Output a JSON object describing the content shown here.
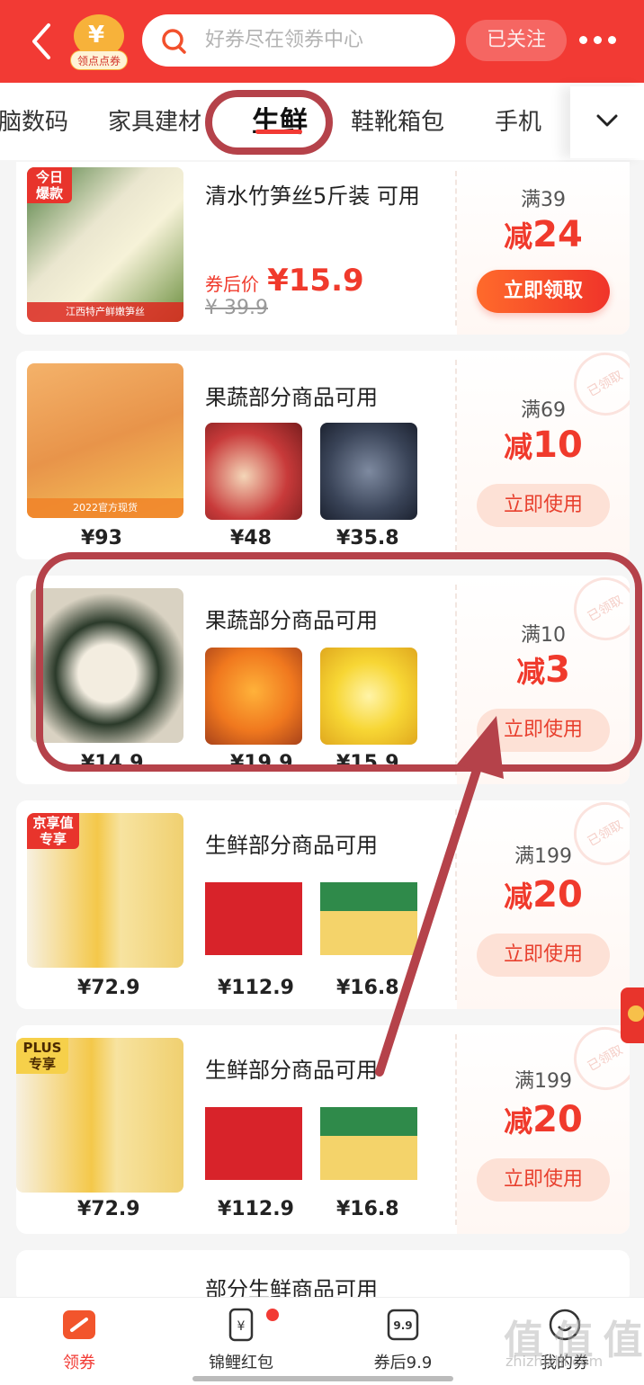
{
  "header": {
    "coupon_center_tag": "领点点券",
    "search_placeholder": "好券尽在领券中心",
    "follow_label": "已关注"
  },
  "tabs": [
    "脑数码",
    "家具建材",
    "生鲜",
    "鞋靴箱包",
    "手机"
  ],
  "active_tab": "生鲜",
  "cards": [
    {
      "badge": "今日爆款",
      "title": "清水竹笋丝5斤装 可用",
      "after_label": "券后价",
      "after_price": "¥15.9",
      "orig_price": "¥ 39.9",
      "threshold": "满39",
      "discount_pre": "减",
      "discount_num": "24",
      "button": "立即领取",
      "thumb_strip": "江西特产鲜嫩笋丝"
    },
    {
      "title": "果蔬部分商品可用",
      "prices": [
        "¥93",
        "¥48",
        "¥35.8"
      ],
      "threshold": "满69",
      "discount_pre": "减",
      "discount_num": "10",
      "button": "立即使用",
      "stamp": "已领取",
      "thumb_strip": "2022官方现货"
    },
    {
      "title": "果蔬部分商品可用",
      "prices": [
        "¥14.9",
        "¥19.9",
        "¥15.9"
      ],
      "threshold": "满10",
      "discount_pre": "减",
      "discount_num": "3",
      "button": "立即使用",
      "stamp": "已领取"
    },
    {
      "badge": "京享值专享",
      "title": "生鲜部分商品可用",
      "prices": [
        "¥72.9",
        "¥112.9",
        "¥16.8"
      ],
      "threshold": "满199",
      "discount_pre": "减",
      "discount_num": "20",
      "button": "立即使用",
      "stamp": "已领取"
    },
    {
      "badge": "PLUS专享",
      "title": "生鲜部分商品可用",
      "prices": [
        "¥72.9",
        "¥112.9",
        "¥16.8"
      ],
      "threshold": "满199",
      "discount_pre": "减",
      "discount_num": "20",
      "button": "立即使用",
      "stamp": "已领取"
    },
    {
      "title": "部分生鲜商品可用"
    }
  ],
  "bottom_nav": [
    {
      "label": "领券"
    },
    {
      "label": "锦鲤红包"
    },
    {
      "label": "券后9.9"
    },
    {
      "label": "我的券"
    }
  ],
  "watermark": "值 值 值",
  "watermark_sub": "zhizhizhi.com",
  "colors": {
    "brand": "#f23a34",
    "annotation": "#b5424a"
  }
}
